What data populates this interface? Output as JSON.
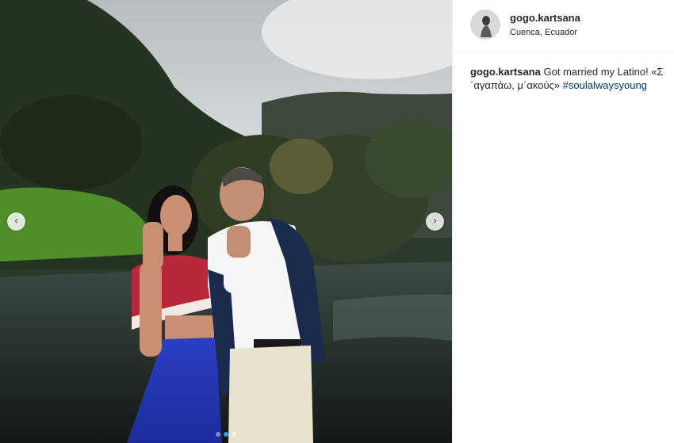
{
  "post": {
    "username": "gogo.kartsana",
    "location": "Cuenca, Ecuador",
    "caption_user": "gogo.kartsana",
    "caption_text": "Got married my Latino! «Σ ΄αγαπάω, μ΄ακούς»",
    "hashtag": "#soulalwaysyoung"
  },
  "carousel": {
    "prev_icon": "‹",
    "next_icon": "›",
    "total_slides": 3,
    "active_slide": 2
  },
  "colors": {
    "link": "#003569",
    "active_dot": "#3897f0",
    "text": "#262626"
  }
}
